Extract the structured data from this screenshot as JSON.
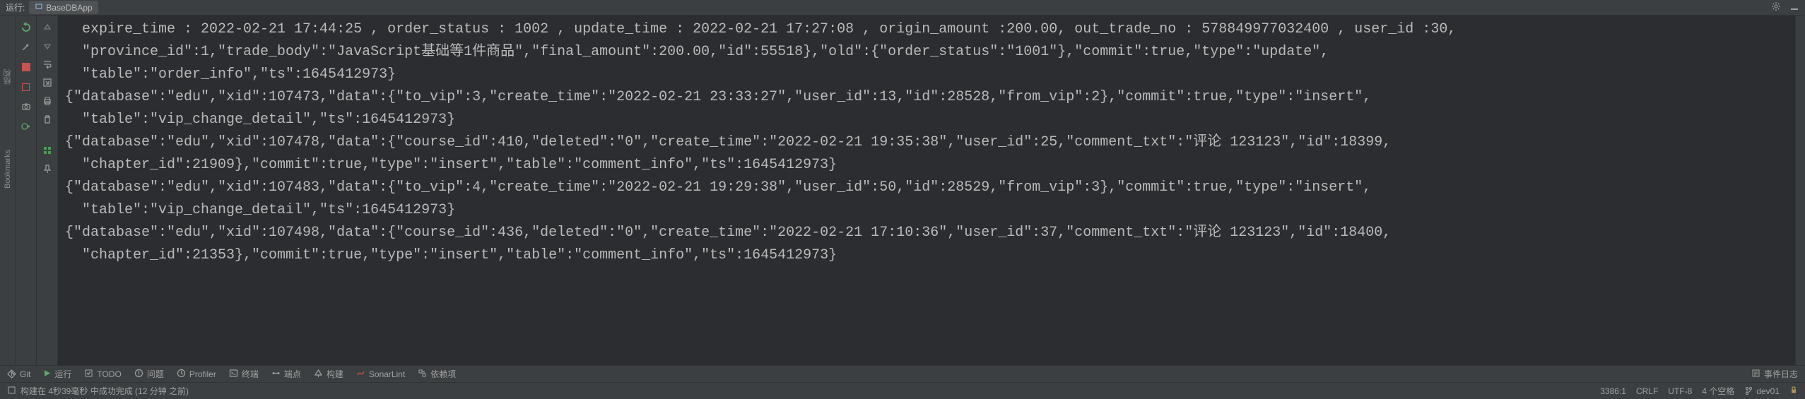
{
  "header": {
    "run_label": "运行:",
    "tab_name": "BaseDBApp"
  },
  "console_lines": [
    "  expire_time : 2022-02-21 17:44:25 , order_status : 1002 , update_time : 2022-02-21 17:27:08 , origin_amount :200.00, out_trade_no : 578849977032400 , user_id :30,",
    "  \"province_id\":1,\"trade_body\":\"JavaScript基础等1件商品\",\"final_amount\":200.00,\"id\":55518},\"old\":{\"order_status\":\"1001\"},\"commit\":true,\"type\":\"update\",",
    "  \"table\":\"order_info\",\"ts\":1645412973}",
    "{\"database\":\"edu\",\"xid\":107473,\"data\":{\"to_vip\":3,\"create_time\":\"2022-02-21 23:33:27\",\"user_id\":13,\"id\":28528,\"from_vip\":2},\"commit\":true,\"type\":\"insert\",",
    "  \"table\":\"vip_change_detail\",\"ts\":1645412973}",
    "{\"database\":\"edu\",\"xid\":107478,\"data\":{\"course_id\":410,\"deleted\":\"0\",\"create_time\":\"2022-02-21 19:35:38\",\"user_id\":25,\"comment_txt\":\"评论 123123\",\"id\":18399,",
    "  \"chapter_id\":21909},\"commit\":true,\"type\":\"insert\",\"table\":\"comment_info\",\"ts\":1645412973}",
    "{\"database\":\"edu\",\"xid\":107483,\"data\":{\"to_vip\":4,\"create_time\":\"2022-02-21 19:29:38\",\"user_id\":50,\"id\":28529,\"from_vip\":3},\"commit\":true,\"type\":\"insert\",",
    "  \"table\":\"vip_change_detail\",\"ts\":1645412973}",
    "{\"database\":\"edu\",\"xid\":107498,\"data\":{\"course_id\":436,\"deleted\":\"0\",\"create_time\":\"2022-02-21 17:10:36\",\"user_id\":37,\"comment_txt\":\"评论 123123\",\"id\":18400,",
    "  \"chapter_id\":21353},\"commit\":true,\"type\":\"insert\",\"table\":\"comment_info\",\"ts\":1645412973}"
  ],
  "left_tabs": {
    "structure": "结构",
    "bookmarks": "Bookmarks"
  },
  "bottom_toolbar": {
    "git": "Git",
    "run": "运行",
    "todo": "TODO",
    "problems": "问题",
    "profiler": "Profiler",
    "terminal": "终端",
    "endpoints": "端点",
    "build": "构建",
    "sonarlint": "SonarLint",
    "dependencies": "依赖项",
    "event_log": "事件日志"
  },
  "status_bar": {
    "build_status": "构建在 4秒39毫秒 中成功完成 (12 分钟 之前)",
    "cursor_position": "3386:1",
    "line_separator": "CRLF",
    "encoding": "UTF-8",
    "indent": "4 个空格",
    "branch": "dev01"
  }
}
